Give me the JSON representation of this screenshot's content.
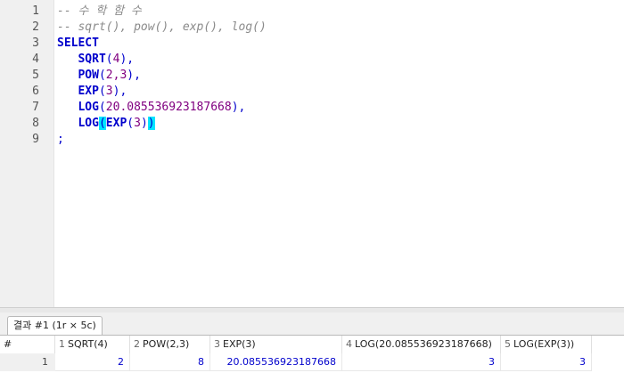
{
  "editor": {
    "line_numbers": [
      "1",
      "2",
      "3",
      "4",
      "5",
      "6",
      "7",
      "8",
      "9"
    ],
    "lines": [
      {
        "comment": "-- 수 학 함 수"
      },
      {
        "comment": "-- sqrt(), pow(), exp(), log()"
      },
      {
        "keyword": "SELECT"
      },
      {
        "fn": "SQRT",
        "open": "(",
        "arg": "4",
        "close": "),",
        "indent": "   "
      },
      {
        "fn": "POW",
        "open": "(",
        "arg": "2,3",
        "close": "),",
        "indent": "   "
      },
      {
        "fn": "EXP",
        "open": "(",
        "arg": "3",
        "close": "),",
        "indent": "   "
      },
      {
        "fn": "LOG",
        "open": "(",
        "arg": "20.085536923187668",
        "close": "),",
        "indent": "   "
      },
      {
        "fn": "LOG",
        "open": "(",
        "inner_fn": "EXP",
        "inner_open": "(",
        "arg": "3",
        "inner_close": ")",
        "close": ")",
        "indent": "   "
      },
      {
        "punct": ";"
      }
    ]
  },
  "results": {
    "tab_label": "결과 #1 (1r × 5c)",
    "row_header_label": "#",
    "columns": [
      {
        "index": "1",
        "name": "SQRT(4)"
      },
      {
        "index": "2",
        "name": "POW(2,3)"
      },
      {
        "index": "3",
        "name": "EXP(3)"
      },
      {
        "index": "4",
        "name": "LOG(20.085536923187668)"
      },
      {
        "index": "5",
        "name": "LOG(EXP(3))"
      }
    ],
    "rows": [
      {
        "num": "1",
        "values": [
          "2",
          "8",
          "20.085536923187668",
          "3",
          "3"
        ]
      }
    ]
  }
}
